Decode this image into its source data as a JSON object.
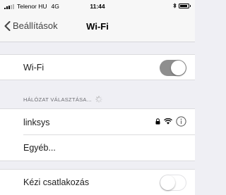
{
  "status_bar": {
    "carrier": "Telenor HU",
    "network_type": "4G",
    "time": "11:44",
    "battery_level": 0.9
  },
  "nav": {
    "back_label": "Beállítások",
    "title": "Wi-Fi"
  },
  "wifi_toggle": {
    "label": "Wi-Fi",
    "state": "on"
  },
  "network_section": {
    "header": "HÁLÓZAT VÁLASZTÁSA...",
    "networks": [
      {
        "name": "linksys",
        "secured": true
      }
    ],
    "other_label": "Egyéb..."
  },
  "manual_join": {
    "label": "Kézi csatlakozás",
    "state": "off"
  },
  "icons": {
    "back": "chevron-left-icon",
    "lock": "lock-icon",
    "wifi": "wifi-icon",
    "info": "info-icon",
    "spinner": "loading-spinner-icon",
    "bluetooth": "bluetooth-icon",
    "battery": "battery-icon"
  },
  "colors": {
    "toggle_on": "#8e8e8e",
    "background": "#efeff4"
  }
}
